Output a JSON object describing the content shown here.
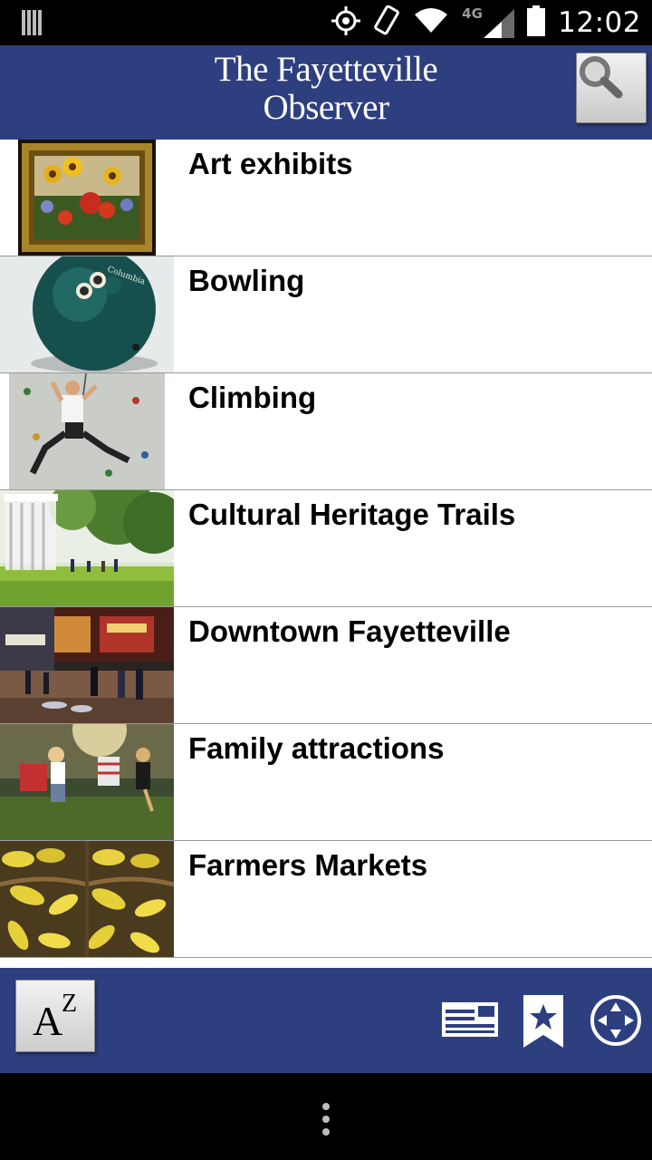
{
  "status_bar": {
    "time": "12:02",
    "network_label": "4G",
    "icons": [
      "barcode-icon",
      "gps-icon",
      "rotate-icon",
      "wifi-icon",
      "signal-icon",
      "battery-icon"
    ]
  },
  "header": {
    "logo_line1": "The Fayetteville",
    "logo_line2": "Observer",
    "background_color": "#2e3f80",
    "search_icon": "search-icon"
  },
  "list": {
    "items": [
      {
        "label": "Art exhibits",
        "thumbnail": "painting of sunflowers in gold frame"
      },
      {
        "label": "Bowling",
        "thumbnail": "green bowling ball"
      },
      {
        "label": "Climbing",
        "thumbnail": "boy on climbing wall"
      },
      {
        "label": "Cultural Heritage Trails",
        "thumbnail": "white gazebo in park"
      },
      {
        "label": "Downtown Fayetteville",
        "thumbnail": "evening street scene"
      },
      {
        "label": "Family attractions",
        "thumbnail": "children dancing outdoors"
      },
      {
        "label": "Farmers Markets",
        "thumbnail": "baskets of yellow squash"
      }
    ]
  },
  "bottom_bar": {
    "az_letter_a": "A",
    "az_letter_z": "Z",
    "icons": [
      "newspaper-icon",
      "bookmark-star-icon",
      "compass-icon"
    ]
  },
  "nav_bar": {
    "menu_icon": "overflow-menu-icon"
  }
}
